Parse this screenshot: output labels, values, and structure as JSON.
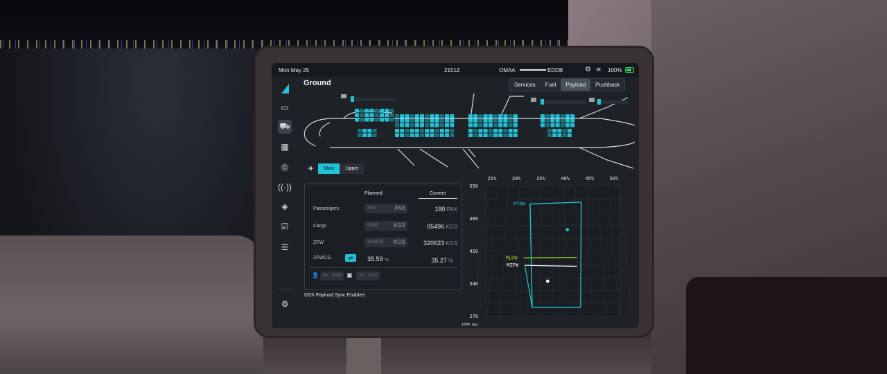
{
  "statusbar": {
    "date": "Mon May 25",
    "time": "2151Z",
    "origin": "OMAA",
    "destination": "EDDB",
    "battery": "100%"
  },
  "page": {
    "title": "Ground"
  },
  "tabs": [
    {
      "label": "Services",
      "active": false
    },
    {
      "label": "Fuel",
      "active": false
    },
    {
      "label": "Payload",
      "active": true
    },
    {
      "label": "Pushback",
      "active": false
    }
  ],
  "deck_toggle": {
    "main": "Main",
    "upper": "Upper",
    "active": "Main"
  },
  "payload": {
    "planned_header": "Planned",
    "current_header": "Current",
    "rows": [
      {
        "label": "Passengers",
        "planned": "458",
        "planned_unit": "PAX",
        "current": "180",
        "current_unit": "PAX"
      },
      {
        "label": "Cargo",
        "planned": "5496",
        "planned_unit": "KGS",
        "current": "05496",
        "current_unit": "KGS"
      },
      {
        "label": "ZFW",
        "planned": "343975",
        "planned_unit": "KGS",
        "current": "320623",
        "current_unit": "KGS"
      },
      {
        "label": "ZFWCG",
        "planned": "35.59",
        "planned_unit": "%",
        "current": "35.27",
        "current_unit": "%"
      }
    ],
    "pax_weight": "84",
    "pax_weight_unit": "KGS",
    "bag_weight": "20",
    "bag_weight_unit": "KGS"
  },
  "sync_status": "GSX Payload Sync Enabled",
  "icons": {
    "settings": "gear-icon",
    "wifi": "wifi-icon",
    "sidebar": [
      "clipboard-icon",
      "truck-icon",
      "calculator-icon",
      "compass-icon",
      "radio-icon",
      "warning-icon",
      "checklist-icon",
      "sliders-icon",
      "gear-icon"
    ]
  },
  "colors": {
    "accent": "#22c2d6",
    "mldw": "#9ad421",
    "screen_bg": "#1e2227"
  },
  "chart_data": {
    "type": "scatter",
    "title": "",
    "x_tick_labels": [
      "25%",
      "30%",
      "35%",
      "40%",
      "45%",
      "50%"
    ],
    "y_tick_labels": [
      "550",
      "480",
      "410",
      "340",
      "270"
    ],
    "xlim": [
      25,
      50
    ],
    "ylim": [
      270,
      550
    ],
    "unit_label": "x 1000 kgs",
    "envelope_labels": {
      "mtow": "MTOW",
      "mldw": "MLDW",
      "mzfw": "MZFW"
    },
    "mtow_envelope": {
      "x": [
        33.2,
        42.8,
        42.7,
        33.6
      ],
      "y": [
        512,
        516,
        290,
        290
      ]
    },
    "mldw_line": {
      "x": [
        32.0,
        42.0
      ],
      "y": [
        396,
        397
      ]
    },
    "mzfw_line": {
      "x": [
        32.2,
        42.0
      ],
      "y": [
        380,
        378
      ]
    },
    "points": [
      {
        "name": "planned",
        "x": 40.2,
        "y": 457,
        "shape": "diamond-cyan"
      },
      {
        "name": "current",
        "x": 36.5,
        "y": 346,
        "shape": "diamond-white"
      }
    ]
  }
}
